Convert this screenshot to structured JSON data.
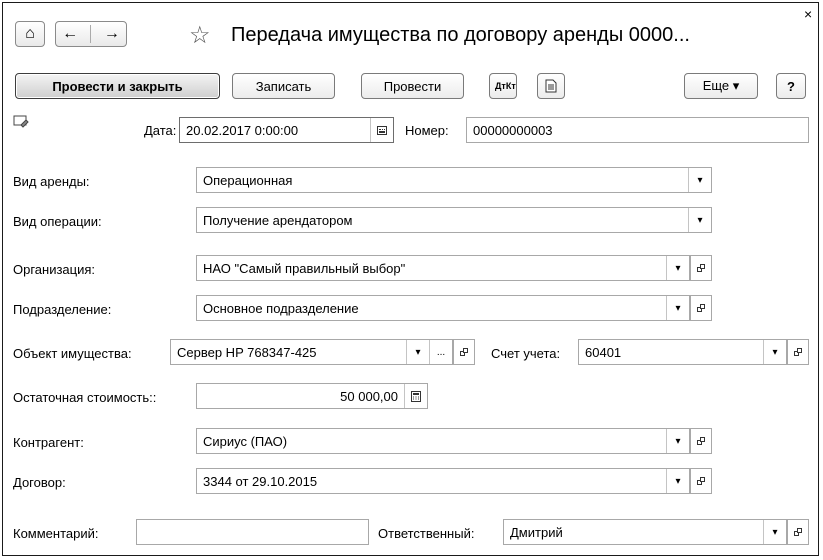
{
  "window": {
    "title": "Передача имущества по договору аренды 0000...",
    "close_glyph": "×"
  },
  "nav": {
    "home_glyph": "⌂",
    "back_glyph": "←",
    "forward_glyph": "→",
    "star_glyph": "☆"
  },
  "toolbar": {
    "post_close_label": "Провести и закрыть",
    "save_label": "Записать",
    "post_label": "Провести",
    "dtkt_label": "ДтКт",
    "more_label": "Еще ▾",
    "help_label": "?"
  },
  "form": {
    "date_label": "Дата:",
    "date_value": "20.02.2017  0:00:00",
    "number_label": "Номер:",
    "number_value": "00000000003",
    "rent_type_label": "Вид аренды:",
    "rent_type_value": "Операционная",
    "operation_label": "Вид операции:",
    "operation_value": "Получение арендатором",
    "org_label": "Организация:",
    "org_value": "НАО \"Самый правильный выбор\"",
    "division_label": "Подразделение:",
    "division_value": "Основное подразделение",
    "asset_label": "Объект имущества:",
    "asset_value": "Сервер HP 768347-425",
    "account_label": "Счет учета:",
    "account_value": "60401",
    "residual_label": "Остаточная стоимость::",
    "residual_value": "50 000,00",
    "counterparty_label": "Контрагент:",
    "counterparty_value": "Сириус (ПАО)",
    "contract_label": "Договор:",
    "contract_value": "3344 от 29.10.2015",
    "comment_label": "Комментарий:",
    "comment_value": "",
    "responsible_label": "Ответственный:",
    "responsible_value": "Дмитрий"
  },
  "glyphs": {
    "dropdown": "▾",
    "ellipsis": "..."
  }
}
